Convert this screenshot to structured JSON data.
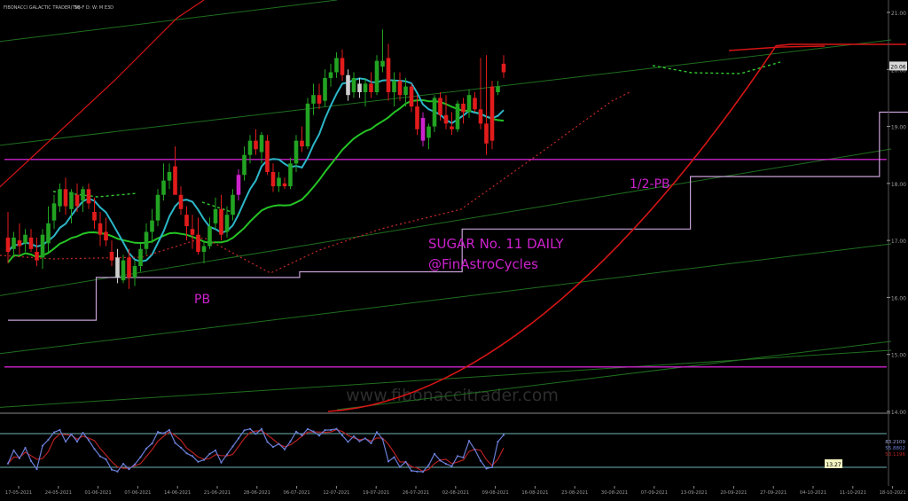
{
  "header": {
    "title": "FIBONACCI GALACTIC TRADER(TM)",
    "instrument": "SB-F D: W: M E3D"
  },
  "watermark": "www.fibonaccitrader.com",
  "annotations": {
    "title_line1": "SUGAR No. 11 DAILY",
    "title_line2": "@FinAstroCycles",
    "pb": "PB",
    "half_pb": "1/2-PB"
  },
  "colors": {
    "background": "#000000",
    "up_candle": "#22a322",
    "down_candle": "#e21b1b",
    "magenta": "#cc22cc",
    "cyan_ma": "#2cb6c8",
    "green_ma": "#24c324",
    "red_curve": "#d51515",
    "dotted_green": "#31c931",
    "dotted_red": "#c92a2a",
    "channel_green": "#1f6e1f",
    "step_line": "#c8a0d8",
    "osc_blue": "#6b7fd8",
    "osc_red": "#b52020",
    "osc_levels": "#6fb5b5"
  },
  "chart_data": {
    "type": "candlestick",
    "title": "SUGAR No. 11 DAILY",
    "ylim": [
      14.0,
      21.0
    ],
    "y_ticks": [
      "21.00",
      "20.00",
      "19.00",
      "18.00",
      "17.00",
      "16.00",
      "15.00",
      "14.00"
    ],
    "current_price_label": "20.06",
    "x_ticks": [
      "17-05-2021",
      "24-05-2021",
      "01-06-2021",
      "07-06-2021",
      "14-06-2021",
      "21-06-2021",
      "28-06-2021",
      "06-07-2021",
      "12-07-2021",
      "19-07-2021",
      "26-07-2021",
      "02-08-2021",
      "09-08-2021",
      "16-08-2021",
      "23-08-2021",
      "30-08-2021",
      "07-09-2021",
      "13-09-2021",
      "20-09-2021",
      "27-09-2021",
      "04-10-2021",
      "11-10-2021",
      "18-10-2021"
    ],
    "candles": [
      {
        "o": 17.05,
        "h": 17.5,
        "l": 16.6,
        "c": 16.8
      },
      {
        "o": 16.85,
        "h": 17.15,
        "l": 16.7,
        "c": 17.05
      },
      {
        "o": 17.0,
        "h": 17.3,
        "l": 16.75,
        "c": 16.9
      },
      {
        "o": 16.95,
        "h": 17.2,
        "l": 16.8,
        "c": 17.1
      },
      {
        "o": 17.05,
        "h": 17.2,
        "l": 16.8,
        "c": 16.85
      },
      {
        "o": 16.8,
        "h": 17.05,
        "l": 16.55,
        "c": 16.65
      },
      {
        "o": 16.7,
        "h": 17.2,
        "l": 16.5,
        "c": 17.1
      },
      {
        "o": 16.95,
        "h": 17.6,
        "l": 16.8,
        "c": 17.3
      },
      {
        "o": 17.35,
        "h": 17.8,
        "l": 17.2,
        "c": 17.65
      },
      {
        "o": 17.6,
        "h": 18.0,
        "l": 17.5,
        "c": 17.9
      },
      {
        "o": 17.9,
        "h": 18.1,
        "l": 17.45,
        "c": 17.6
      },
      {
        "o": 17.55,
        "h": 17.9,
        "l": 17.3,
        "c": 17.85
      },
      {
        "o": 17.8,
        "h": 18.0,
        "l": 17.5,
        "c": 17.6
      },
      {
        "o": 17.7,
        "h": 17.95,
        "l": 17.5,
        "c": 17.9
      },
      {
        "o": 17.9,
        "h": 18.0,
        "l": 17.55,
        "c": 17.65
      },
      {
        "o": 17.5,
        "h": 17.75,
        "l": 17.2,
        "c": 17.35
      },
      {
        "o": 17.3,
        "h": 17.5,
        "l": 16.9,
        "c": 17.1
      },
      {
        "o": 17.15,
        "h": 17.4,
        "l": 16.9,
        "c": 17.0
      },
      {
        "o": 16.8,
        "h": 17.0,
        "l": 16.55,
        "c": 16.65
      },
      {
        "o": 16.7,
        "h": 16.85,
        "l": 16.25,
        "c": 16.35
      },
      {
        "o": 16.3,
        "h": 16.75,
        "l": 16.25,
        "c": 16.65
      },
      {
        "o": 16.7,
        "h": 16.85,
        "l": 16.15,
        "c": 16.35
      },
      {
        "o": 16.35,
        "h": 16.65,
        "l": 16.2,
        "c": 16.55
      },
      {
        "o": 16.55,
        "h": 16.95,
        "l": 16.45,
        "c": 16.85
      },
      {
        "o": 16.85,
        "h": 17.3,
        "l": 16.75,
        "c": 17.15
      },
      {
        "o": 17.15,
        "h": 17.55,
        "l": 16.95,
        "c": 17.35
      },
      {
        "o": 17.35,
        "h": 17.9,
        "l": 17.25,
        "c": 17.8
      },
      {
        "o": 17.8,
        "h": 18.35,
        "l": 17.7,
        "c": 18.05
      },
      {
        "o": 18.05,
        "h": 18.35,
        "l": 17.9,
        "c": 18.2
      },
      {
        "o": 18.3,
        "h": 18.65,
        "l": 17.95,
        "c": 17.8
      },
      {
        "o": 17.8,
        "h": 17.95,
        "l": 17.45,
        "c": 17.55
      },
      {
        "o": 17.45,
        "h": 17.6,
        "l": 17.0,
        "c": 17.25
      },
      {
        "o": 17.2,
        "h": 17.45,
        "l": 16.85,
        "c": 17.1
      },
      {
        "o": 17.1,
        "h": 17.4,
        "l": 16.75,
        "c": 16.8
      },
      {
        "o": 16.8,
        "h": 17.0,
        "l": 16.6,
        "c": 16.9
      },
      {
        "o": 16.9,
        "h": 17.4,
        "l": 16.85,
        "c": 17.25
      },
      {
        "o": 17.3,
        "h": 17.75,
        "l": 17.2,
        "c": 17.55
      },
      {
        "o": 17.55,
        "h": 17.8,
        "l": 17.0,
        "c": 17.1
      },
      {
        "o": 17.15,
        "h": 17.6,
        "l": 17.05,
        "c": 17.45
      },
      {
        "o": 17.45,
        "h": 17.9,
        "l": 17.35,
        "c": 17.8
      },
      {
        "o": 17.8,
        "h": 18.25,
        "l": 17.7,
        "c": 18.15
      },
      {
        "o": 18.15,
        "h": 18.65,
        "l": 18.05,
        "c": 18.5
      },
      {
        "o": 18.5,
        "h": 18.85,
        "l": 18.35,
        "c": 18.75
      },
      {
        "o": 18.75,
        "h": 18.95,
        "l": 18.5,
        "c": 18.6
      },
      {
        "o": 18.55,
        "h": 18.9,
        "l": 18.35,
        "c": 18.85
      },
      {
        "o": 18.75,
        "h": 18.85,
        "l": 18.15,
        "c": 18.2
      },
      {
        "o": 18.2,
        "h": 18.35,
        "l": 17.85,
        "c": 17.95
      },
      {
        "o": 17.95,
        "h": 18.2,
        "l": 17.85,
        "c": 18.1
      },
      {
        "o": 18.0,
        "h": 18.1,
        "l": 17.9,
        "c": 17.95
      },
      {
        "o": 17.95,
        "h": 18.45,
        "l": 17.9,
        "c": 18.35
      },
      {
        "o": 18.35,
        "h": 18.85,
        "l": 18.2,
        "c": 18.75
      },
      {
        "o": 18.75,
        "h": 19.0,
        "l": 18.55,
        "c": 18.65
      },
      {
        "o": 18.65,
        "h": 19.5,
        "l": 18.6,
        "c": 19.4
      },
      {
        "o": 19.4,
        "h": 19.75,
        "l": 19.2,
        "c": 19.55
      },
      {
        "o": 19.55,
        "h": 19.75,
        "l": 19.3,
        "c": 19.4
      },
      {
        "o": 19.45,
        "h": 20.0,
        "l": 19.35,
        "c": 19.85
      },
      {
        "o": 19.85,
        "h": 20.1,
        "l": 19.7,
        "c": 19.95
      },
      {
        "o": 19.95,
        "h": 20.3,
        "l": 19.85,
        "c": 20.2
      },
      {
        "o": 20.2,
        "h": 20.35,
        "l": 19.8,
        "c": 19.9
      },
      {
        "o": 19.9,
        "h": 20.0,
        "l": 19.45,
        "c": 19.55
      },
      {
        "o": 19.6,
        "h": 19.95,
        "l": 19.5,
        "c": 19.85
      },
      {
        "o": 19.75,
        "h": 19.85,
        "l": 19.5,
        "c": 19.6
      },
      {
        "o": 19.6,
        "h": 19.85,
        "l": 19.35,
        "c": 19.75
      },
      {
        "o": 19.75,
        "h": 19.95,
        "l": 19.5,
        "c": 19.6
      },
      {
        "o": 19.6,
        "h": 20.25,
        "l": 19.55,
        "c": 20.15
      },
      {
        "o": 20.05,
        "h": 20.7,
        "l": 19.95,
        "c": 20.15
      },
      {
        "o": 20.2,
        "h": 20.45,
        "l": 19.45,
        "c": 19.6
      },
      {
        "o": 19.6,
        "h": 19.95,
        "l": 19.35,
        "c": 19.8
      },
      {
        "o": 19.8,
        "h": 19.95,
        "l": 19.45,
        "c": 19.55
      },
      {
        "o": 19.55,
        "h": 19.85,
        "l": 19.35,
        "c": 19.7
      },
      {
        "o": 19.7,
        "h": 19.75,
        "l": 19.25,
        "c": 19.35
      },
      {
        "o": 19.35,
        "h": 19.55,
        "l": 18.85,
        "c": 18.95
      },
      {
        "o": 19.15,
        "h": 19.25,
        "l": 18.65,
        "c": 18.75
      },
      {
        "o": 18.8,
        "h": 19.05,
        "l": 18.6,
        "c": 19.0
      },
      {
        "o": 19.0,
        "h": 19.55,
        "l": 18.9,
        "c": 19.5
      },
      {
        "o": 19.5,
        "h": 19.6,
        "l": 19.1,
        "c": 19.2
      },
      {
        "o": 19.2,
        "h": 19.55,
        "l": 18.95,
        "c": 19.05
      },
      {
        "o": 19.0,
        "h": 19.25,
        "l": 18.85,
        "c": 18.95
      },
      {
        "o": 18.95,
        "h": 19.45,
        "l": 18.9,
        "c": 19.4
      },
      {
        "o": 19.4,
        "h": 19.5,
        "l": 19.05,
        "c": 19.25
      },
      {
        "o": 19.25,
        "h": 19.65,
        "l": 19.15,
        "c": 19.55
      },
      {
        "o": 19.5,
        "h": 19.6,
        "l": 19.25,
        "c": 19.3
      },
      {
        "o": 19.3,
        "h": 20.2,
        "l": 18.95,
        "c": 19.05
      },
      {
        "o": 19.05,
        "h": 20.25,
        "l": 18.5,
        "c": 18.7
      },
      {
        "o": 19.7,
        "h": 19.8,
        "l": 18.6,
        "c": 18.75
      },
      {
        "o": 19.6,
        "h": 19.8,
        "l": 19.55,
        "c": 19.7
      },
      {
        "o": 20.1,
        "h": 20.25,
        "l": 19.85,
        "c": 19.95
      }
    ],
    "magenta_candle_indices": [
      40,
      72
    ],
    "white_candle_indices": [
      19,
      59,
      61
    ],
    "horizontal_lines": [
      18.42,
      14.78
    ],
    "step_line": [
      [
        0,
        15.6
      ],
      [
        15.3,
        15.6
      ],
      [
        15.3,
        16.35
      ],
      [
        50.6,
        16.35
      ],
      [
        50.6,
        16.45
      ],
      [
        78.8,
        16.45
      ],
      [
        78.8,
        17.2
      ],
      [
        118.4,
        17.2
      ],
      [
        118.4,
        18.12
      ],
      [
        151.2,
        18.12
      ],
      [
        151.2,
        19.25
      ],
      [
        173.4,
        19.25
      ]
    ],
    "oscillator": {
      "levels": [
        75,
        25
      ],
      "value_labels": [
        "83.2109",
        "55.8802",
        "53.1196"
      ],
      "current_label": "13.27"
    }
  }
}
